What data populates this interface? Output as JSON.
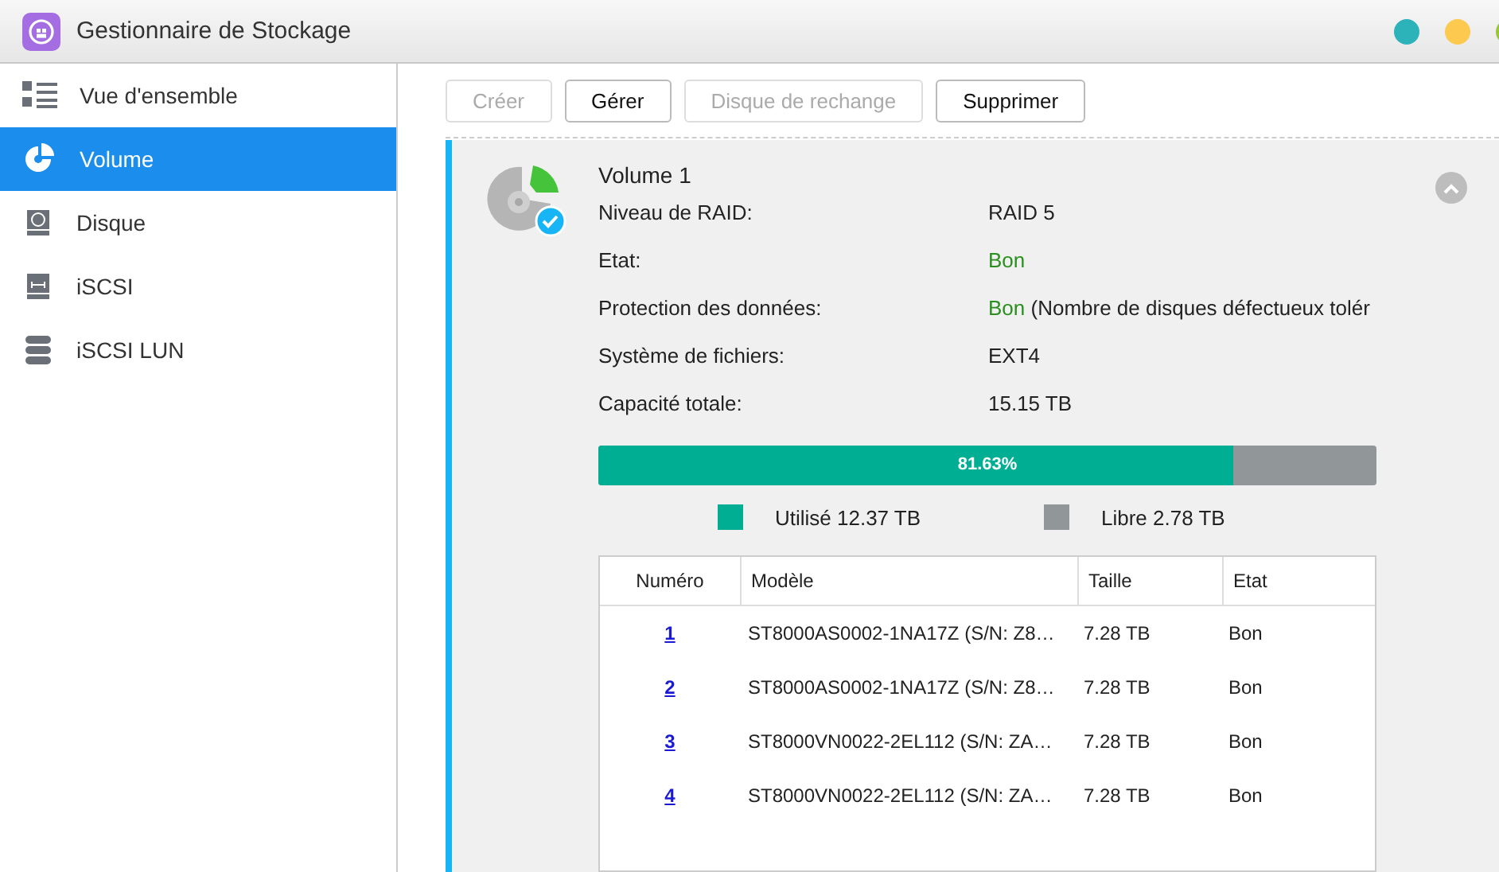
{
  "window": {
    "title": "Gestionnaire de Stockage",
    "controls": [
      {
        "color": "#2bb3b9"
      },
      {
        "color": "#fdc94f"
      },
      {
        "color": "#9dc53a"
      }
    ]
  },
  "sidebar": {
    "items": [
      {
        "label": "Vue d'ensemble",
        "kind": "overview",
        "selected": false
      },
      {
        "label": "Volume",
        "kind": "volume",
        "selected": true
      },
      {
        "label": "Disque",
        "kind": "disk",
        "selected": false
      },
      {
        "label": "iSCSI",
        "kind": "iscsi",
        "selected": false
      },
      {
        "label": "iSCSI LUN",
        "kind": "lun",
        "selected": false
      }
    ]
  },
  "toolbar": [
    {
      "label": "Créer",
      "disabled": true
    },
    {
      "label": "Gérer",
      "disabled": false
    },
    {
      "label": "Disque de rechange",
      "disabled": true
    },
    {
      "label": "Supprimer",
      "disabled": false
    }
  ],
  "volume": {
    "title": "Volume 1",
    "expanded": true,
    "details": [
      {
        "label": "Niveau de RAID:",
        "value": "RAID 5",
        "good": false
      },
      {
        "label": "Etat:",
        "value": "Bon",
        "good": true
      },
      {
        "label": "Protection des données:",
        "value": "Bon",
        "note": " (Nombre de disques défectueux tolér",
        "good": true
      },
      {
        "label": "Système de fichiers:",
        "value": "EXT4",
        "good": false
      },
      {
        "label": "Capacité totale:",
        "value": "15.15 TB",
        "good": false
      }
    ],
    "usage": {
      "level": 0.8163,
      "reading": "81.63%"
    },
    "legend": [
      {
        "label": "Utilisé 12.37 TB",
        "color": "#00ae94"
      },
      {
        "label": "Libre 2.78 TB",
        "color": "#919698"
      }
    ],
    "table": {
      "columns": [
        "Numéro",
        "Modèle",
        "Taille",
        "Etat"
      ],
      "rows": [
        [
          "1",
          "ST8000AS0002-1NA17Z (S/N: Z8…",
          "7.28 TB",
          "Bon"
        ],
        [
          "2",
          "ST8000AS0002-1NA17Z (S/N: Z8…",
          "7.28 TB",
          "Bon"
        ],
        [
          "3",
          "ST8000VN0022-2EL112 (S/N: ZA…",
          "7.28 TB",
          "Bon"
        ],
        [
          "4",
          "ST8000VN0022-2EL112 (S/N: ZA…",
          "7.28 TB",
          "Bon"
        ]
      ]
    }
  }
}
